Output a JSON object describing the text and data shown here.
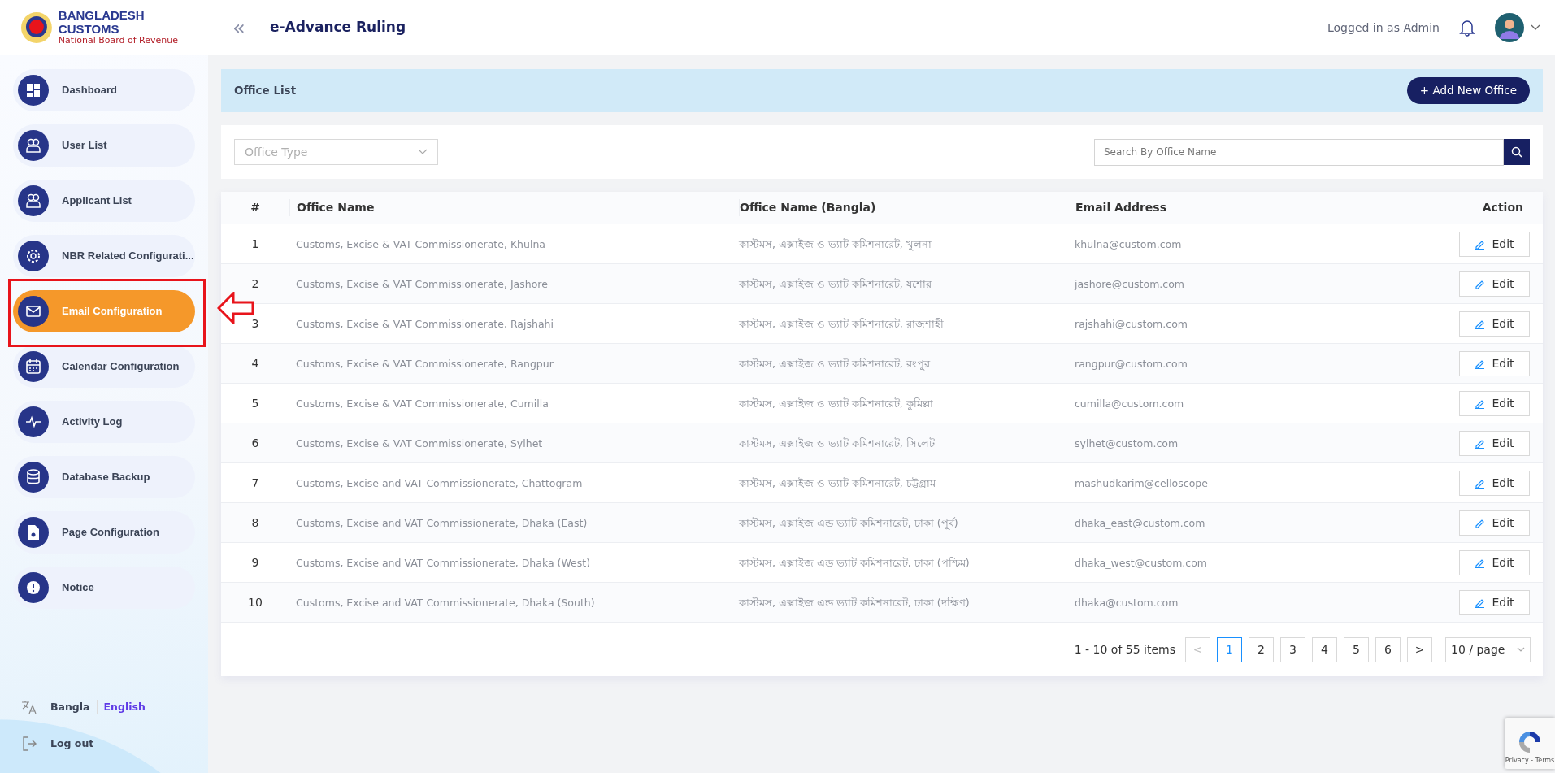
{
  "header": {
    "brand_title": "BANGLADESH CUSTOMS",
    "brand_subtitle": "National Board of Revenue",
    "collapse_icon": "«",
    "app_title": "e-Advance Ruling",
    "user_text": "Logged in as Admin"
  },
  "sidebar": {
    "items": [
      {
        "label": "Dashboard",
        "selected": false
      },
      {
        "label": "User List",
        "selected": false
      },
      {
        "label": "Applicant List",
        "selected": false
      },
      {
        "label": "NBR Related Configurati...",
        "selected": false
      },
      {
        "label": "Email Configuration",
        "selected": true
      },
      {
        "label": "Calendar Configuration",
        "selected": false
      },
      {
        "label": "Activity Log",
        "selected": false
      },
      {
        "label": "Database Backup",
        "selected": false
      },
      {
        "label": "Page Configuration",
        "selected": false
      },
      {
        "label": "Notice",
        "selected": false
      }
    ],
    "languages": [
      {
        "label": "Bangla",
        "selected": false
      },
      {
        "label": "English",
        "selected": true
      }
    ],
    "logout": "Log out"
  },
  "page": {
    "title": "Office List",
    "add_button": "+ Add New Office",
    "filter": {
      "placeholder": "Office Type"
    },
    "search": {
      "placeholder": "Search By Office Name"
    }
  },
  "table": {
    "columns": [
      "#",
      "Office Name",
      "Office Name (Bangla)",
      "Email Address",
      "Action"
    ],
    "rows": [
      {
        "index": "1",
        "name": "Customs, Excise & VAT Commissionerate, Khulna",
        "name_bn": "কাস্টমস, এক্সাইজ ও ভ্যাট কমিশনারেট, খুলনা",
        "email": "khulna@custom.com",
        "action": "Edit"
      },
      {
        "index": "2",
        "name": "Customs, Excise & VAT Commissionerate, Jashore",
        "name_bn": "কাস্টমস, এক্সাইজ ও ভ্যাট কমিশনারেট, যশোর",
        "email": "jashore@custom.com",
        "action": "Edit"
      },
      {
        "index": "3",
        "name": "Customs, Excise & VAT Commissionerate, Rajshahi",
        "name_bn": "কাস্টমস, এক্সাইজ ও ভ্যাট কমিশনারেট, রাজশাহী",
        "email": "rajshahi@custom.com",
        "action": "Edit"
      },
      {
        "index": "4",
        "name": "Customs, Excise & VAT Commissionerate, Rangpur",
        "name_bn": "কাস্টমস, এক্সাইজ ও ভ্যাট কমিশনারেট, রংপুর",
        "email": "rangpur@custom.com",
        "action": "Edit"
      },
      {
        "index": "5",
        "name": "Customs, Excise & VAT Commissionerate, Cumilla",
        "name_bn": "কাস্টমস, এক্সাইজ ও ভ্যাট কমিশনারেট, কুমিল্লা",
        "email": "cumilla@custom.com",
        "action": "Edit"
      },
      {
        "index": "6",
        "name": "Customs, Excise & VAT Commissionerate, Sylhet",
        "name_bn": "কাস্টমস, এক্সাইজ ও ভ্যাট কমিশনারেট, সিলেট",
        "email": "sylhet@custom.com",
        "action": "Edit"
      },
      {
        "index": "7",
        "name": "Customs, Excise and VAT Commissionerate, Chattogram",
        "name_bn": "কাস্টমস, এক্সাইজ ও ভ্যাট কমিশনারেট, চট্টগ্রাম",
        "email": "mashudkarim@celloscope",
        "action": "Edit"
      },
      {
        "index": "8",
        "name": "Customs, Excise and VAT Commissionerate, Dhaka (East)",
        "name_bn": "কাস্টমস, এক্সাইজ এন্ড ভ্যাট কমিশনারেট, ঢাকা (পূর্ব)",
        "email": "dhaka_east@custom.com",
        "action": "Edit"
      },
      {
        "index": "9",
        "name": "Customs, Excise and VAT Commissionerate, Dhaka (West)",
        "name_bn": "কাস্টমস, এক্সাইজ এন্ড ভ্যাট কমিশনারেট, ঢাকা (পশ্চিম)",
        "email": "dhaka_west@custom.com",
        "action": "Edit"
      },
      {
        "index": "10",
        "name": "Customs, Excise and VAT Commissionerate, Dhaka (South)",
        "name_bn": "কাস্টমস, এক্সাইজ এন্ড ভ্যাট কমিশনারেট, ঢাকা (দক্ষিণ)",
        "email": "dhaka@custom.com",
        "action": "Edit"
      }
    ]
  },
  "pagination": {
    "summary": "1 - 10 of 55 items",
    "prev": "<",
    "next": ">",
    "pages": [
      {
        "label": "1",
        "selected": true
      },
      {
        "label": "2",
        "selected": false
      },
      {
        "label": "3",
        "selected": false
      },
      {
        "label": "4",
        "selected": false
      },
      {
        "label": "5",
        "selected": false
      },
      {
        "label": "6",
        "selected": false
      }
    ],
    "page_size": "10 / page"
  },
  "recaptcha": {
    "text": "Privacy - Terms"
  }
}
